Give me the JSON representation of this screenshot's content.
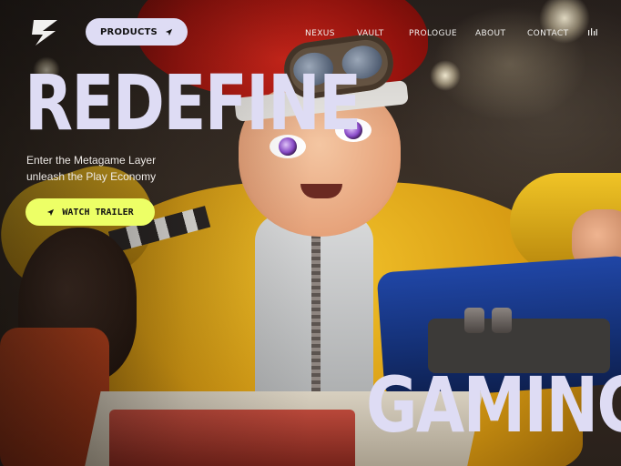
{
  "header": {
    "logo_icon": "zap-logo-icon",
    "products_label": "PRODUCTS",
    "products_icon": "location-arrow-icon",
    "nav": [
      {
        "label": "NEXUS"
      },
      {
        "label": "VAULT"
      },
      {
        "label": "PROLOGUE"
      },
      {
        "label": "ABOUT"
      },
      {
        "label": "CONTACT"
      }
    ],
    "audio_icon": "audio-bars-icon"
  },
  "hero": {
    "headline_top": "REDEFINE",
    "tagline_line1": "Enter the Metagame Layer",
    "tagline_line2": "unleash the Play Economy",
    "cta_label": "WATCH TRAILER",
    "cta_icon": "location-arrow-icon",
    "headline_bottom": "GAMING"
  },
  "colors": {
    "headline": "#dedcf4",
    "products_button": "#dedcf4",
    "cta_button": "#edff66",
    "nav_text": "#f1f0ee"
  }
}
